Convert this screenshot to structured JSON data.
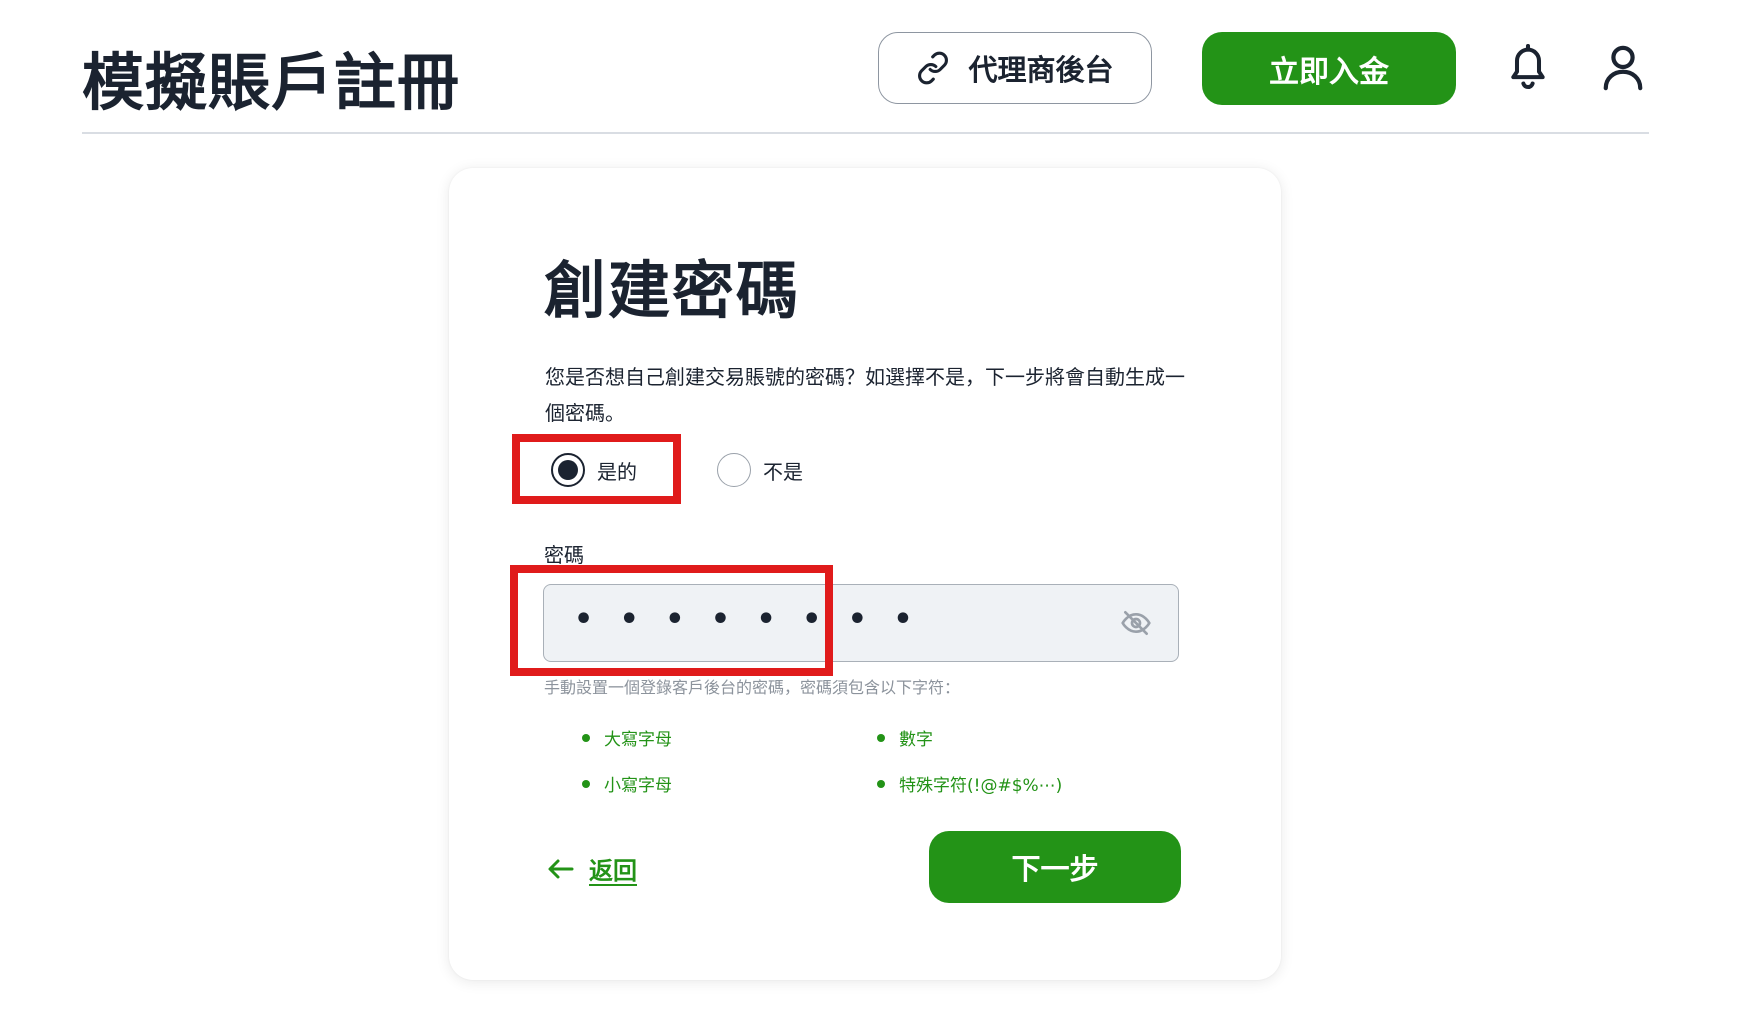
{
  "header": {
    "title": "模擬賬戶註冊",
    "agent_label": "代理商後台",
    "deposit_label": "立即入金"
  },
  "form": {
    "title": "創建密碼",
    "question": "您是否想自己創建交易賬號的密碼？如選擇不是，下一步將會自動生成一個密碼。",
    "options": [
      {
        "label": "是的",
        "selected": true
      },
      {
        "label": "不是",
        "selected": false
      }
    ],
    "password_label": "密碼",
    "password_value": "• • • • • • • •",
    "hint": "手動設置一個登錄客戶後台的密碼，密碼須包含以下字符：",
    "requirements": [
      "大寫字母",
      "數字",
      "小寫字母",
      "特殊字符(!@#$%⋯)"
    ],
    "back_label": "返回",
    "next_label": "下一步"
  },
  "colors": {
    "accent": "#239317",
    "highlight": "#e01b1b",
    "text": "#1b2330",
    "input_bg": "#eff2f5"
  },
  "icons": [
    "link-icon",
    "bell-icon",
    "user-icon",
    "eye-off-icon",
    "arrow-left-icon"
  ]
}
